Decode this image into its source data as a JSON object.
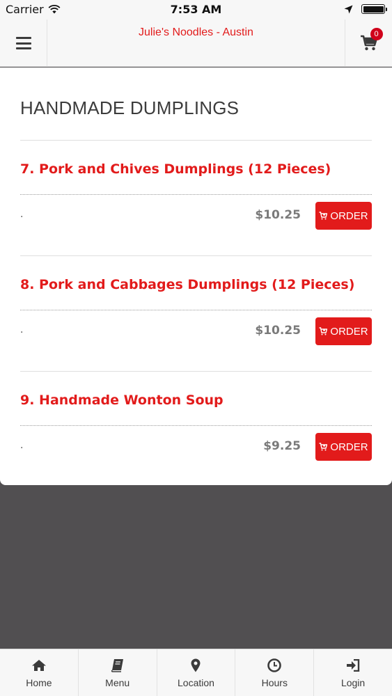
{
  "status": {
    "carrier": "Carrier",
    "time": "7:53 AM"
  },
  "header": {
    "title": "Julie's Noodles - Austin",
    "cart_count": "0"
  },
  "section": {
    "title": "HANDMADE DUMPLINGS"
  },
  "items": [
    {
      "name": "7. Pork and Chives Dumplings (12 Pieces)",
      "description": ".",
      "price": "$10.25",
      "button": "ORDER"
    },
    {
      "name": "8. Pork and Cabbages Dumplings (12 Pieces)",
      "description": ".",
      "price": "$10.25",
      "button": "ORDER"
    },
    {
      "name": "9. Handmade Wonton Soup",
      "description": ".",
      "price": "$9.25",
      "button": "ORDER"
    }
  ],
  "tabs": [
    {
      "label": "Home",
      "icon": "home-icon"
    },
    {
      "label": "Menu",
      "icon": "book-icon"
    },
    {
      "label": "Location",
      "icon": "map-pin-icon"
    },
    {
      "label": "Hours",
      "icon": "clock-icon"
    },
    {
      "label": "Login",
      "icon": "sign-in-icon"
    }
  ],
  "colors": {
    "accent": "#e21b1b",
    "badge": "#d0021b",
    "background": "#514f51"
  }
}
